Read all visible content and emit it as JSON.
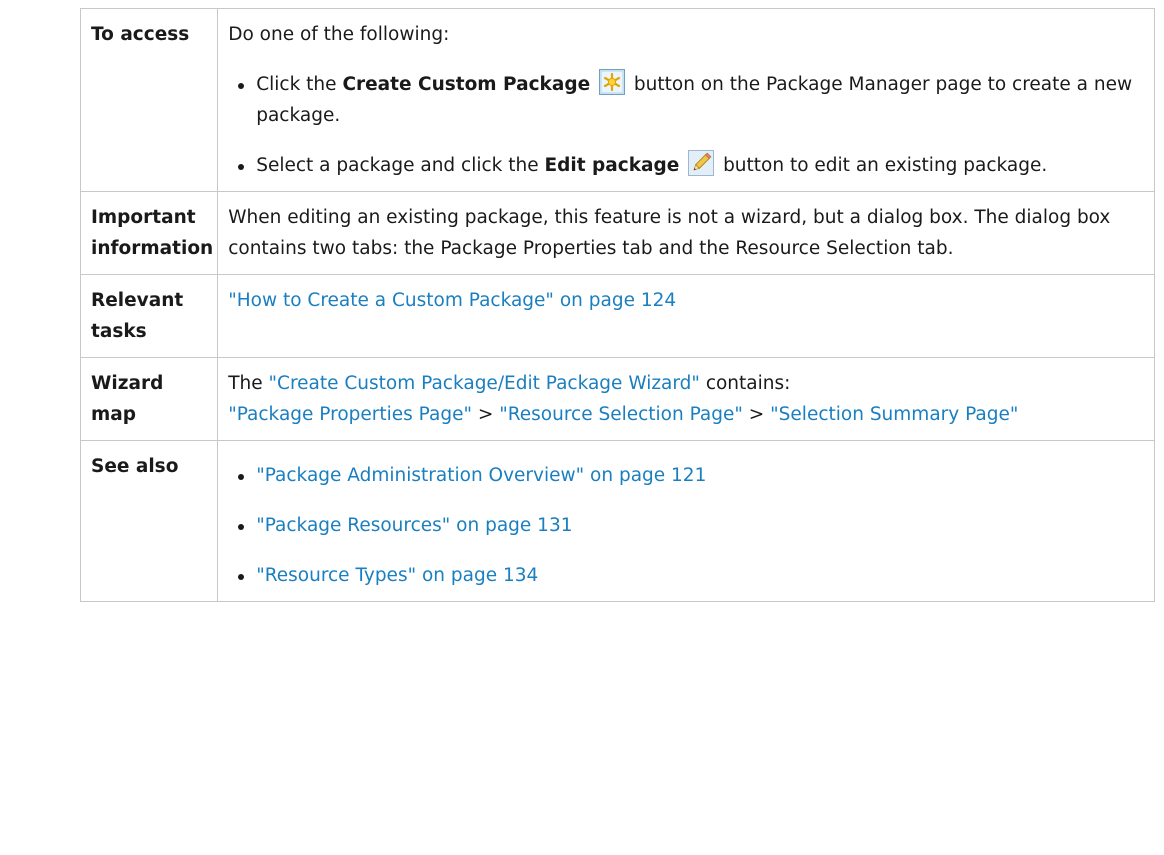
{
  "access": {
    "label": "To access",
    "intro": "Do one of the following:",
    "item1": {
      "pre": "Click the ",
      "bold": "Create Custom Package",
      "post": " button on the Package Manager page to create a new package.",
      "icon": "create-custom-package-icon"
    },
    "item2": {
      "pre": "Select a package and click the ",
      "bold": "Edit package",
      "post": " button to edit an existing package.",
      "icon": "edit-package-icon"
    }
  },
  "important": {
    "label": "Important information",
    "text": "When editing an existing package, this feature is not a wizard, but a dialog box. The dialog box contains two tabs: the Package Properties tab and the Resource Selection tab."
  },
  "tasks": {
    "label": "Relevant tasks",
    "link": "\"How to Create a Custom Package\" on page 124"
  },
  "wizard": {
    "label": "Wizard map",
    "pre": "The ",
    "link": "\"Create Custom Package/Edit Package Wizard\"",
    "post": " contains:",
    "step1": "\"Package Properties Page\"",
    "sep1": " > ",
    "step2": "\"Resource Selection Page\"",
    "sep2": " > ",
    "step3": "\"Selection Summary Page\""
  },
  "see_also": {
    "label": "See also",
    "links": [
      "\"Package Administration Overview\" on page 121",
      "\"Package Resources\" on page 131",
      "\"Resource Types\" on page 134"
    ]
  },
  "colors": {
    "link": "#1a7fc0",
    "border": "#c8c8c8",
    "text": "#1a1a1a"
  }
}
